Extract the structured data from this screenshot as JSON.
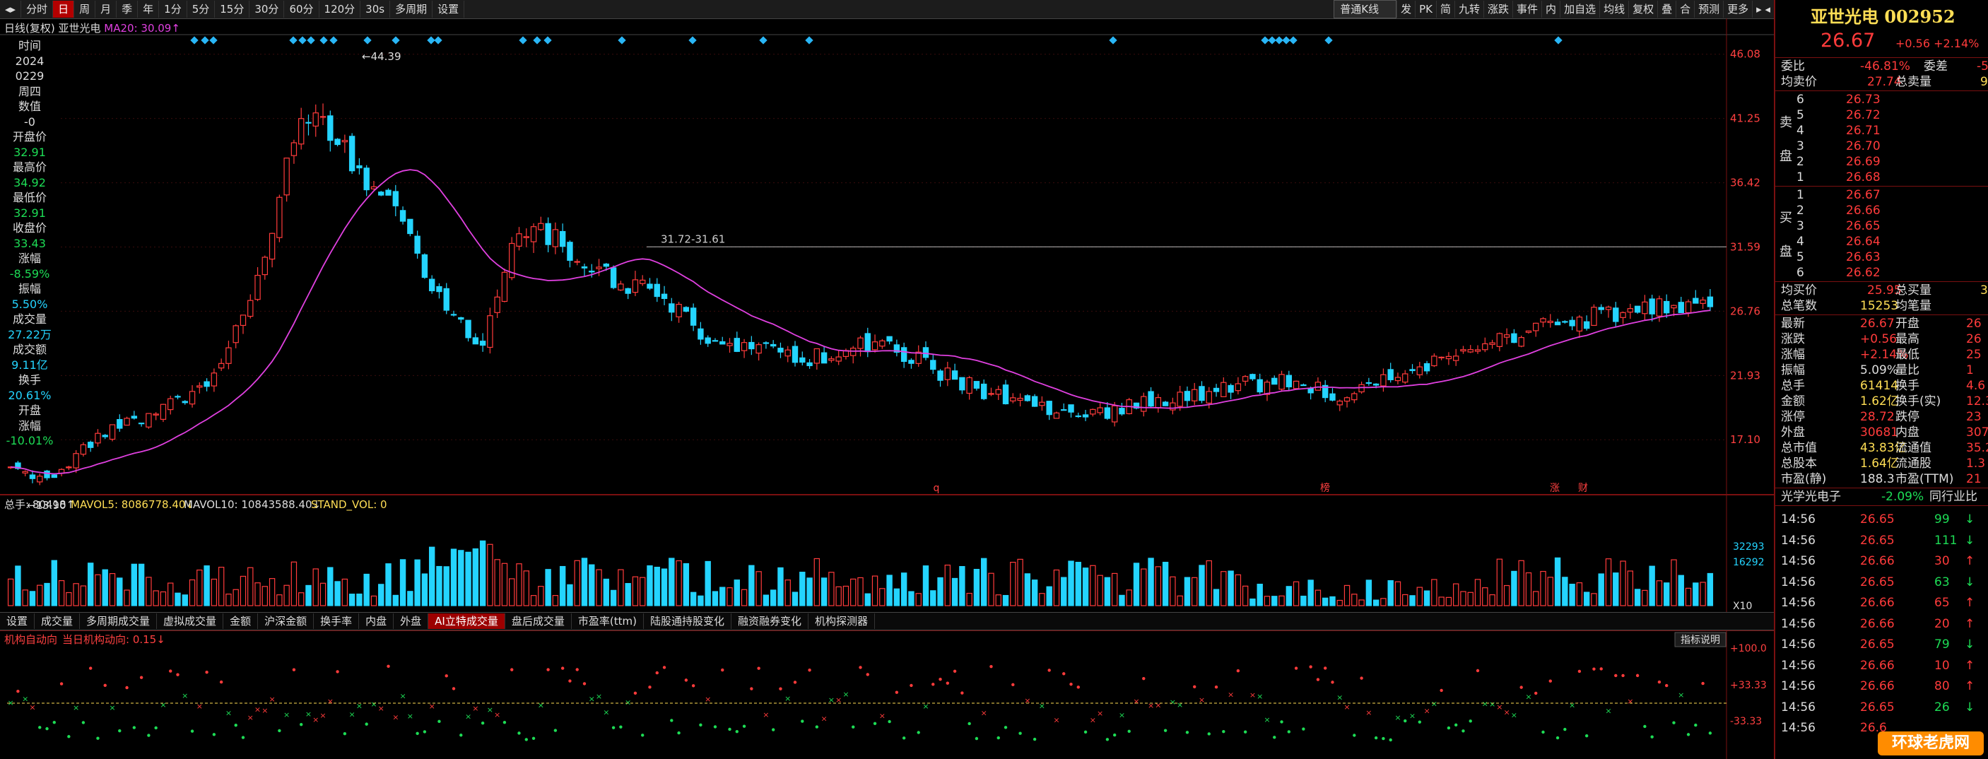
{
  "toolbar": {
    "periods": [
      "分时",
      "日",
      "周",
      "月",
      "季",
      "年",
      "1分",
      "5分",
      "15分",
      "30分",
      "60分",
      "120分",
      "30s",
      "多周期",
      "设置"
    ],
    "active": "日",
    "right_select": "普通K线",
    "right_items": [
      "发",
      "PK",
      "简",
      "九转",
      "涨跌",
      "事件",
      "内",
      "加自选",
      "均线",
      "复权",
      "叠",
      "合",
      "预测",
      "更多"
    ]
  },
  "chart_header": {
    "title": "日线(复权)",
    "stock": "亚世光电",
    "ma_label": "MA20: 30.09↑"
  },
  "info_column": [
    {
      "t": "时间",
      "c": "lbl"
    },
    {
      "t": "2024",
      "c": "lbl"
    },
    {
      "t": "0229",
      "c": "lbl"
    },
    {
      "t": "周四",
      "c": "lbl"
    },
    {
      "t": "数值",
      "c": "lbl"
    },
    {
      "t": "-0",
      "c": "lbl"
    },
    {
      "t": "开盘价",
      "c": "lbl"
    },
    {
      "t": "32.91",
      "c": "dn"
    },
    {
      "t": "最高价",
      "c": "lbl"
    },
    {
      "t": "34.92",
      "c": "dn"
    },
    {
      "t": "最低价",
      "c": "lbl"
    },
    {
      "t": "32.91",
      "c": "dn"
    },
    {
      "t": "收盘价",
      "c": "lbl"
    },
    {
      "t": "33.43",
      "c": "dn"
    },
    {
      "t": "涨幅",
      "c": "lbl"
    },
    {
      "t": "-8.59%",
      "c": "dn"
    },
    {
      "t": "振幅",
      "c": "lbl"
    },
    {
      "t": "5.50%",
      "c": "cy"
    },
    {
      "t": "成交量",
      "c": "lbl"
    },
    {
      "t": "27.22万",
      "c": "cy"
    },
    {
      "t": "成交额",
      "c": "lbl"
    },
    {
      "t": "9.11亿",
      "c": "cy"
    },
    {
      "t": "换手",
      "c": "lbl"
    },
    {
      "t": "20.61%",
      "c": "cy"
    },
    {
      "t": "开盘",
      "c": "lbl"
    },
    {
      "t": "涨幅",
      "c": "lbl"
    },
    {
      "t": "-10.01%",
      "c": "dn"
    }
  ],
  "price_axis": [
    "46.08",
    "41.25",
    "36.42",
    "31.59",
    "26.76",
    "21.93",
    "17.10"
  ],
  "annotations": {
    "high": "44.39",
    "low": "13.90",
    "range": "31.72-31.61"
  },
  "event_marks": [
    "q",
    "榜",
    "涨",
    "财"
  ],
  "volume_header": {
    "total": "总手: 80418↑",
    "mavol5": "MAVOL5: 8086778.40↓",
    "mavol10": "MAVOL10: 10843588.40↓",
    "stand": "STAND_VOL: 0"
  },
  "volume_axis": [
    "32293",
    "16292",
    "X10"
  ],
  "sub_tabs": [
    "设置",
    "成交量",
    "多周期成交量",
    "虚拟成交量",
    "金额",
    "沪深金额",
    "换手率",
    "内盘",
    "外盘",
    "AI立特成交量",
    "盘后成交量",
    "市盈率(ttm)",
    "陆股通持股变化",
    "融资融券变化",
    "机构探测器"
  ],
  "sub_tab_active": "AI立特成交量",
  "indicator": {
    "title": "机构自动向",
    "value": "当日机构动向: 0.15↓",
    "btn": "指标说明",
    "axis": [
      "+100.0",
      "+33.33",
      "-33.33"
    ]
  },
  "right_panel": {
    "name": "亚世光电 002952",
    "price": "26.67",
    "change": "+0.56  +2.14%",
    "webi": {
      "k1": "委比",
      "v1": "-46.81%",
      "k2": "委差",
      "v2": "-5"
    },
    "avg_sell": {
      "k": "均卖价",
      "v": "27.74",
      "k2": "总卖量",
      "v2": "9"
    },
    "sell_label": "卖盘",
    "buy_label": "买盘",
    "sells": [
      {
        "n": "6",
        "p": "26.73"
      },
      {
        "n": "5",
        "p": "26.72"
      },
      {
        "n": "4",
        "p": "26.71"
      },
      {
        "n": "3",
        "p": "26.70"
      },
      {
        "n": "2",
        "p": "26.69"
      },
      {
        "n": "1",
        "p": "26.68"
      }
    ],
    "buys": [
      {
        "n": "1",
        "p": "26.67"
      },
      {
        "n": "2",
        "p": "26.66"
      },
      {
        "n": "3",
        "p": "26.65"
      },
      {
        "n": "4",
        "p": "26.64"
      },
      {
        "n": "5",
        "p": "26.63"
      },
      {
        "n": "6",
        "p": "26.62"
      }
    ],
    "avg_buy": {
      "k": "均买价",
      "v": "25.95",
      "k2": "总买量",
      "v2": "3"
    },
    "total_count": {
      "k": "总笔数",
      "v": "15253",
      "k2": "均笔量",
      "v2": ""
    },
    "stats": [
      {
        "k": "最新",
        "v": "26.67",
        "vc": "red",
        "k2": "开盘",
        "v2": "26"
      },
      {
        "k": "涨跌",
        "v": "+0.56",
        "vc": "red",
        "k2": "最高",
        "v2": "26"
      },
      {
        "k": "涨幅",
        "v": "+2.14%",
        "vc": "red",
        "k2": "最低",
        "v2": "25"
      },
      {
        "k": "振幅",
        "v": "5.09%",
        "vc": "wht",
        "k2": "量比",
        "v2": "1"
      },
      {
        "k": "总手",
        "v": "61414",
        "vc": "yel",
        "k2": "换手",
        "v2": "4.6"
      },
      {
        "k": "金额",
        "v": "1.62亿",
        "vc": "yel",
        "k2": "换手(实)",
        "v2": "12.3"
      },
      {
        "k": "涨停",
        "v": "28.72",
        "vc": "red",
        "k2": "跌停",
        "v2": "23"
      },
      {
        "k": "外盘",
        "v": "30681",
        "vc": "red",
        "k2": "内盘",
        "v2": "307"
      },
      {
        "k": "总市值",
        "v": "43.83亿",
        "vc": "yel",
        "k2": "流通值",
        "v2": "35.2"
      },
      {
        "k": "总股本",
        "v": "1.64亿",
        "vc": "yel",
        "k2": "流通股",
        "v2": "1.3"
      },
      {
        "k": "市盈(静)",
        "v": "188.3",
        "vc": "wht",
        "k2": "市盈(TTM)",
        "v2": "21"
      }
    ],
    "sector": {
      "name": "光学光电子",
      "pct": "-2.09%",
      "btn": "同行业比"
    },
    "ticks": [
      {
        "t": "14:56",
        "p": "26.65",
        "v": "99",
        "d": "dn"
      },
      {
        "t": "14:56",
        "p": "26.65",
        "v": "111",
        "d": "dn"
      },
      {
        "t": "14:56",
        "p": "26.66",
        "v": "30",
        "d": "up"
      },
      {
        "t": "14:56",
        "p": "26.65",
        "v": "63",
        "d": "dn"
      },
      {
        "t": "14:56",
        "p": "26.66",
        "v": "65",
        "d": "up"
      },
      {
        "t": "14:56",
        "p": "26.66",
        "v": "20",
        "d": "up"
      },
      {
        "t": "14:56",
        "p": "26.65",
        "v": "79",
        "d": "dn"
      },
      {
        "t": "14:56",
        "p": "26.66",
        "v": "10",
        "d": "up"
      },
      {
        "t": "14:56",
        "p": "26.66",
        "v": "80",
        "d": "up"
      },
      {
        "t": "14:56",
        "p": "26.65",
        "v": "26",
        "d": "dn"
      },
      {
        "t": "14:56",
        "p": "26.6",
        "v": "",
        "d": "up"
      }
    ],
    "watermark": "环球老虎网"
  },
  "colors": {
    "up": "#ff3b3b",
    "down": "#24d4ff",
    "ma": "#e040e0",
    "accent": "#b30000"
  },
  "chart_data": {
    "type": "candlestick",
    "ma_series": "MA20",
    "ylim": [
      13.5,
      47.5
    ],
    "ohlc": [],
    "ma20": [],
    "volume": [],
    "indicator": []
  }
}
